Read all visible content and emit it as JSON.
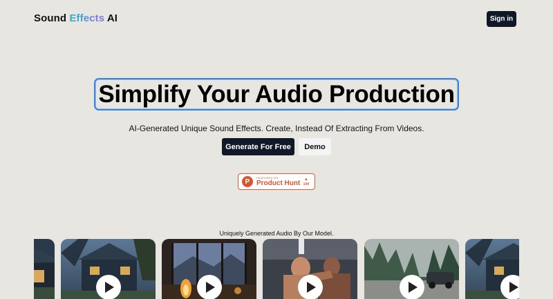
{
  "header": {
    "logo_word1": "Sound",
    "logo_word2": "Effects",
    "logo_word3": "AI",
    "signin_label": "Sign in"
  },
  "hero": {
    "title": "Simplify Your Audio Production",
    "subtitle": "AI-Generated Unique Sound Effects. Create, Instead Of Extracting From Videos.",
    "primary_button": "Generate For Free",
    "secondary_button": "Demo"
  },
  "product_hunt": {
    "featured_label": "FEATURED ON",
    "name": "Product Hunt",
    "votes": "144",
    "logo_letter": "P",
    "upvote_glyph": "▲"
  },
  "gallery": {
    "caption": "Uniquely Generated Audio By Our Model.",
    "cards": [
      {
        "scene": "house-night-partial"
      },
      {
        "scene": "house-night"
      },
      {
        "scene": "campfire-window"
      },
      {
        "scene": "boxing-fight"
      },
      {
        "scene": "car-forest"
      },
      {
        "scene": "house-night-partial"
      }
    ]
  },
  "colors": {
    "background": "#e8e6e1",
    "dark_button": "#111827",
    "accent_blue": "#3b82d8",
    "product_hunt": "#da552f"
  }
}
